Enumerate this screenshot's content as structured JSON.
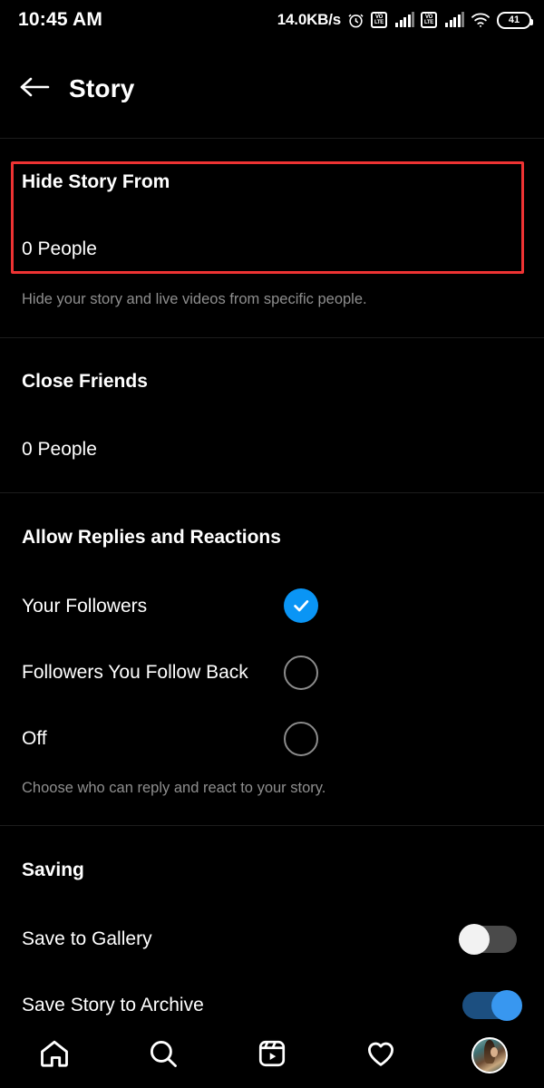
{
  "statusbar": {
    "time": "10:45 AM",
    "network_speed": "14.0KB/s",
    "alarm_icon": "alarm-clock-icon",
    "sim1_label_top": "VO",
    "sim1_label_bottom": "LTE",
    "sim2_label_top": "VO",
    "sim2_label_bottom": "LTE",
    "wifi_icon": "wifi-icon",
    "battery_level": "41"
  },
  "header": {
    "back_icon": "back-arrow-icon",
    "title": "Story"
  },
  "sections": {
    "hide_story": {
      "title": "Hide Story From",
      "value": "0 People",
      "helper": "Hide your story and live videos from specific people.",
      "highlighted": true,
      "highlight_color": "#ee3333"
    },
    "close_friends": {
      "title": "Close Friends",
      "value": "0 People"
    },
    "allow_replies": {
      "title": "Allow Replies and Reactions",
      "helper": "Choose who can reply and react to your story.",
      "options": [
        {
          "label": "Your Followers",
          "selected": true
        },
        {
          "label": "Followers You Follow Back",
          "selected": false
        },
        {
          "label": "Off",
          "selected": false
        }
      ]
    },
    "saving": {
      "title": "Saving",
      "items": [
        {
          "label": "Save to Gallery",
          "enabled": false
        },
        {
          "label": "Save Story to Archive",
          "enabled": true
        }
      ]
    }
  },
  "bottom_nav": {
    "items": [
      {
        "name": "home-icon",
        "label": "Home"
      },
      {
        "name": "search-icon",
        "label": "Search"
      },
      {
        "name": "reels-icon",
        "label": "Reels"
      },
      {
        "name": "heart-icon",
        "label": "Activity"
      },
      {
        "name": "profile-avatar",
        "label": "Profile"
      }
    ]
  },
  "colors": {
    "accent_blue": "#0a95f5",
    "toggle_on": "#3897f0",
    "background": "#000000",
    "muted_text": "#8e8e8e"
  }
}
